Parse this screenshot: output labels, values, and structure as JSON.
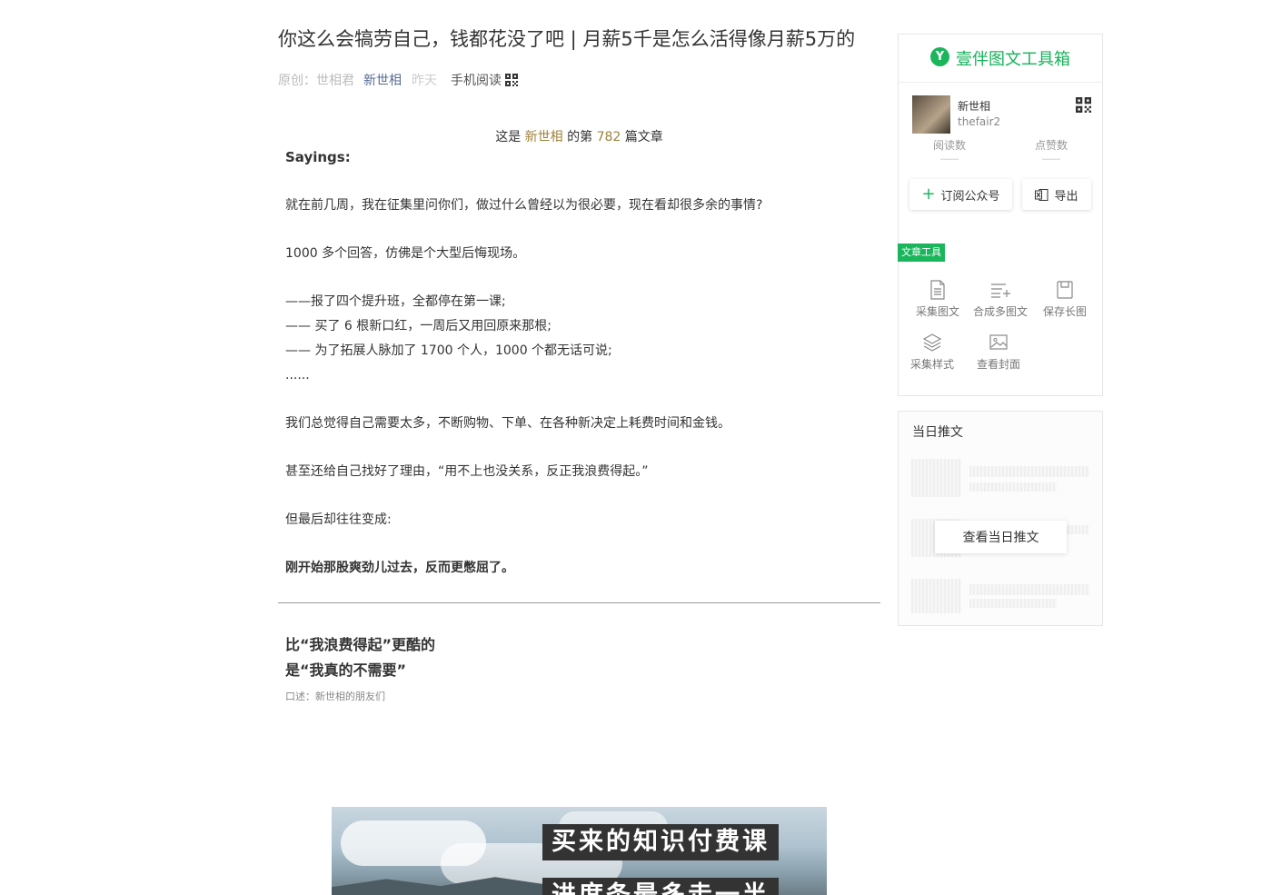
{
  "article": {
    "title": "你这么会犒劳自己，钱都花没了吧 | 月薪5千是怎么活得像月薪5万的",
    "meta": {
      "original_label": "原创：",
      "author": "世相君",
      "account": "新世相",
      "date": "昨天",
      "mobile_read": "手机阅读"
    },
    "intro": {
      "prefix": "这是 ",
      "account": "新世相",
      "mid": " 的第 ",
      "number": "782",
      "suffix": " 篇文章"
    },
    "sayings": "Sayings:",
    "paragraphs": {
      "p1": "就在前几周，我在征集里问你们，做过什么曾经以为很必要，现在看却很多余的事情?",
      "p2": "1000 多个回答，仿佛是个大型后悔现场。",
      "list1": "——报了四个提升班，全都停在第一课;",
      "list2": "—— 买了 6 根新口红，一周后又用回原来那根;",
      "list3": "—— 为了拓展人脉加了 1700 个人，1000 个都无话可说;",
      "ellipsis": "......",
      "p3": "我们总觉得自己需要太多，不断购物、下单、在各种新决定上耗费时间和金钱。",
      "p4": "甚至还给自己找好了理由，“用不上也没关系，反正我浪费得起。”",
      "p5": "但最后却往往变成:",
      "p6": "刚开始那股爽劲儿过去，反而更憋屈了。"
    },
    "section": {
      "line1": "比“我浪费得起”更酷的",
      "line2": "是“我真的不需要”",
      "narrator": "口述：新世相的朋友们"
    },
    "banner": {
      "line1": "买来的知识付费课",
      "line2": "进度条最多走一半"
    }
  },
  "toolbox": {
    "title": "壹伴图文工具箱",
    "logo_letter": "Y",
    "profile": {
      "name": "新世相",
      "id": "thefair2"
    },
    "stats": {
      "reads_label": "阅读数",
      "likes_label": "点赞数",
      "placeholder": "﹏﹏"
    },
    "subscribe_label": "订阅公众号",
    "export_label": "导出",
    "tools_tag": "文章工具",
    "tools": {
      "collect": "采集图文",
      "merge": "合成多图文",
      "save_long": "保存长图",
      "collect_style": "采集样式",
      "view_cover": "查看封面"
    }
  },
  "daily": {
    "title": "当日推文",
    "button": "查看当日推文"
  }
}
